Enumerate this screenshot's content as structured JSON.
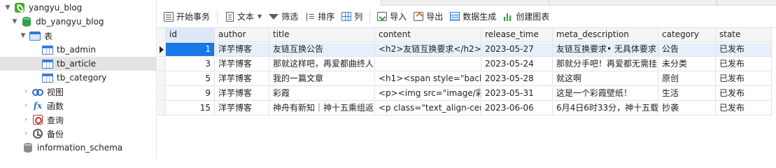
{
  "tree": {
    "connection": "yangyu_blog",
    "database": "db_yangyu_blog",
    "tables_group": "表",
    "tables": [
      "tb_admin",
      "tb_article",
      "tb_category"
    ],
    "selected_table": "tb_article",
    "groups": [
      {
        "label": "视图",
        "icon": "view-icon"
      },
      {
        "label": "函数",
        "icon": "function-icon"
      },
      {
        "label": "查询",
        "icon": "query-icon"
      },
      {
        "label": "备份",
        "icon": "backup-icon"
      }
    ],
    "other_database": "information_schema"
  },
  "toolbar": {
    "begin_transaction": "开始事务",
    "text": "文本",
    "filter": "筛选",
    "sort": "排序",
    "columns": "列",
    "import": "导入",
    "export": "导出",
    "data_generation": "数据生成",
    "create_chart": "创建图表"
  },
  "grid": {
    "columns": [
      "id",
      "author",
      "title",
      "content",
      "release_time",
      "meta_description",
      "category",
      "state"
    ],
    "rows": [
      [
        "1",
        "洋芋博客",
        "友链互换公告",
        "<h2>友链互换要求</h2>",
        "2023-05-27",
        "友链互换要求• 无具体要求",
        "公告",
        "已发布"
      ],
      [
        "3",
        "洋芋博客",
        "那就这样吧，再爱都曲终人",
        "",
        "2023-05-24",
        "那就分手吧！再爱都无需挂",
        "未分类",
        "已发布"
      ],
      [
        "5",
        "洋芋博客",
        "我的一篇文章",
        "<h1><span style=\"back",
        "2023-05-28",
        "就这啊",
        "原创",
        "已发布"
      ],
      [
        "9",
        "洋芋博客",
        "彩霞",
        "<p><img src=\"image/彩",
        "2023-05-31",
        "这是一个彩霞壁纸！",
        "生活",
        "已发布"
      ],
      [
        "15",
        "洋芋博客",
        "神舟有新知｜神十五乘组返",
        "<p class=\"text_align-cer",
        "2023-06-06",
        "6月4日6时33分，神十五载",
        "抄袭",
        "已发布"
      ]
    ],
    "selected_row": 0
  }
}
